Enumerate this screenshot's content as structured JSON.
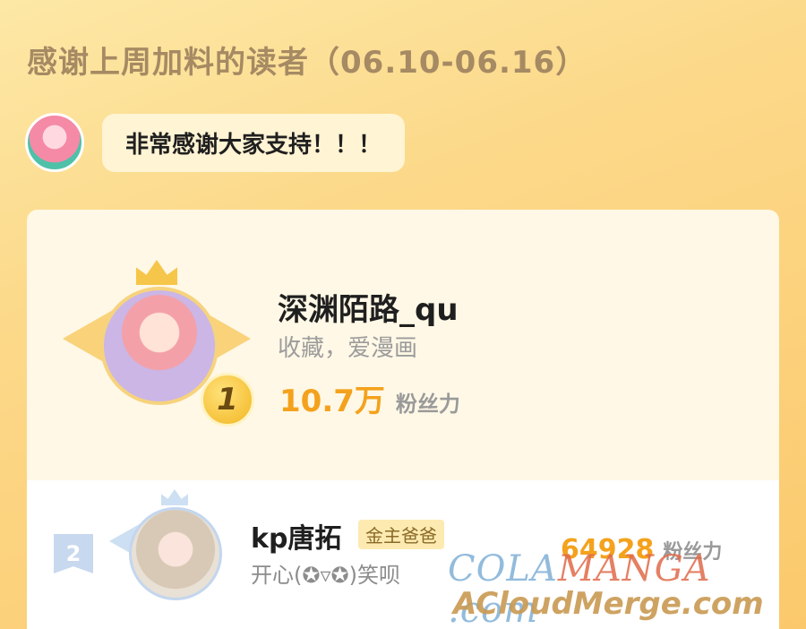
{
  "title": "感谢上周加料的读者（06.10-06.16）",
  "bubble": {
    "text": "非常感谢大家支持！！！"
  },
  "ranking": [
    {
      "rank": "1",
      "name": "深渊陌路_qu",
      "motto": "收藏，爱漫画",
      "fans_value": "10.7万",
      "fans_label": "粉丝力"
    },
    {
      "rank": "2",
      "name": "kp唐拓",
      "tag": "金主爸爸",
      "motto": "开心(✪▿✪)笑呗",
      "fans_value": "64928",
      "fans_label": "粉丝力"
    }
  ],
  "watermark": {
    "line1_a": "COLA",
    "line1_b": "MANGA",
    "line1_c": " .com",
    "line2": "ACloudMerge.com"
  },
  "colors": {
    "accent": "#f4a21d",
    "title": "#a58a63"
  }
}
